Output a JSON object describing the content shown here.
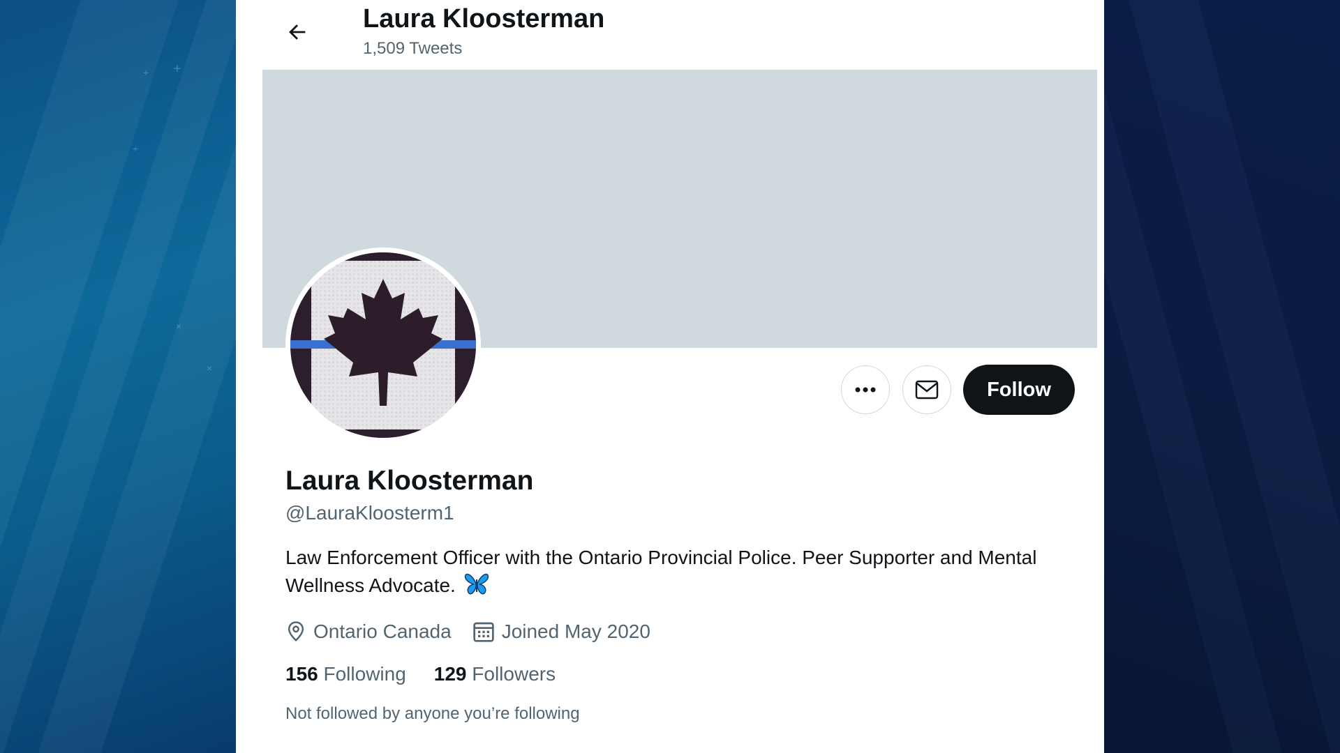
{
  "header": {
    "name": "Laura Kloosterman",
    "tweet_count": "1,509 Tweets",
    "back_icon": "arrow-left-icon"
  },
  "profile": {
    "display_name": "Laura Kloosterman",
    "handle": "@LauraKloosterm1",
    "bio": "Law Enforcement Officer with the Ontario Provincial Police. Peer Supporter and Mental Wellness Advocate.",
    "bio_emoji": "butterfly-emoji",
    "location": "Ontario Canada",
    "joined": "Joined May 2020",
    "following_count": "156",
    "following_label": "Following",
    "followers_count": "129",
    "followers_label": "Followers",
    "followed_by_note": "Not followed by anyone you’re following",
    "avatar": "canadian-flag-thin-blue-line-patch"
  },
  "actions": {
    "more_icon": "more-dots-icon",
    "message_icon": "envelope-icon",
    "follow_label": "Follow"
  },
  "colors": {
    "text_primary": "#0f1419",
    "text_secondary": "#536471",
    "banner": "#cfd9de",
    "follow_button": "#0f1419",
    "butterfly": "#1d9bf0"
  }
}
